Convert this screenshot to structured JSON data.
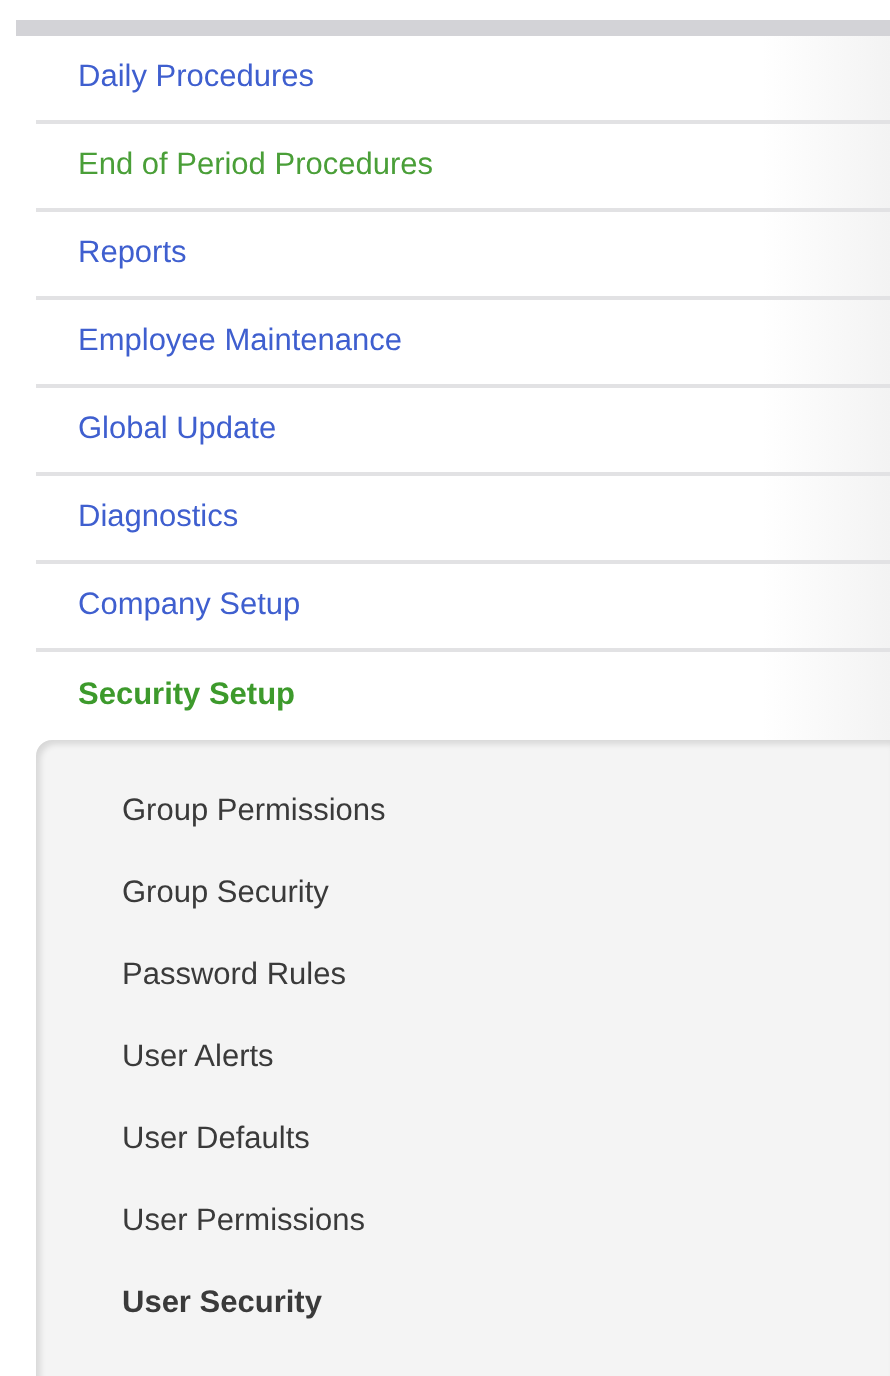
{
  "menu": {
    "items": [
      {
        "label": "Daily Procedures",
        "selected": false,
        "hovered": false
      },
      {
        "label": "End of Period Procedures",
        "selected": false,
        "hovered": true
      },
      {
        "label": "Reports",
        "selected": false,
        "hovered": false
      },
      {
        "label": "Employee Maintenance",
        "selected": false,
        "hovered": false
      },
      {
        "label": "Global Update",
        "selected": false,
        "hovered": false
      },
      {
        "label": "Diagnostics",
        "selected": false,
        "hovered": false
      },
      {
        "label": "Company Setup",
        "selected": false,
        "hovered": false
      },
      {
        "label": "Security Setup",
        "selected": true,
        "hovered": false,
        "expanded": true,
        "children": [
          {
            "label": "Group Permissions",
            "selected": false
          },
          {
            "label": "Group Security",
            "selected": false
          },
          {
            "label": "Password Rules",
            "selected": false
          },
          {
            "label": "User Alerts",
            "selected": false
          },
          {
            "label": "User Defaults",
            "selected": false
          },
          {
            "label": "User Permissions",
            "selected": false
          },
          {
            "label": "User Security",
            "selected": true
          }
        ]
      }
    ]
  }
}
